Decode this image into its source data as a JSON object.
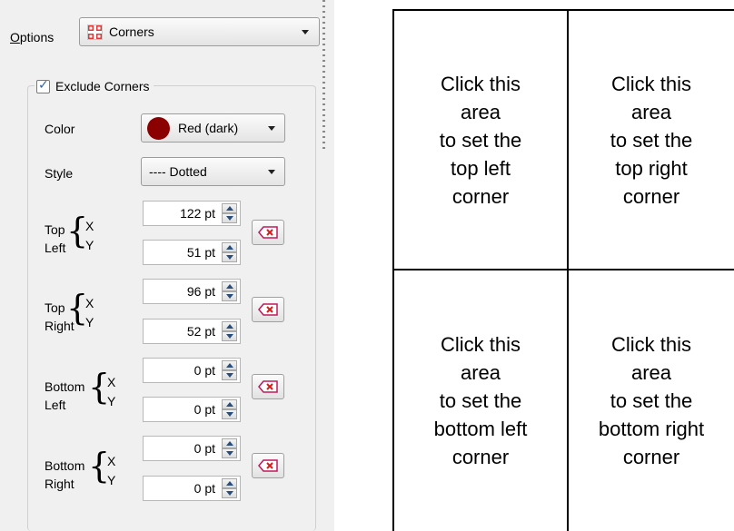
{
  "options": {
    "label_accel": "O",
    "label_rest": "ptions",
    "selected": "Corners"
  },
  "group": {
    "title": "Exclude Corners",
    "checked": true
  },
  "color": {
    "label": "Color",
    "value": "Red (dark)",
    "swatch": "#8b0000"
  },
  "style": {
    "label": "Style",
    "value": "---- Dotted"
  },
  "corners": [
    {
      "label1": "Top",
      "label2": "Left",
      "x": "122 pt",
      "y": "51 pt"
    },
    {
      "label1": "Top",
      "label2": "Right",
      "x": "96 pt",
      "y": "52 pt"
    },
    {
      "label1": "Bottom",
      "label2": "Left",
      "x": "0 pt",
      "y": "0 pt"
    },
    {
      "label1": "Bottom",
      "label2": "Right",
      "x": "0 pt",
      "y": "0 pt"
    }
  ],
  "axis": {
    "x": "X",
    "y": "Y"
  },
  "icons": {
    "corners": "corners-icon",
    "clear": "clear-icon"
  },
  "grid": {
    "top_left": "Click this\narea\nto set the\ntop left\ncorner",
    "top_right": "Click this\narea\nto set the\ntop right\ncorner",
    "bottom_left": "Click this\narea\nto set the\nbottom left\ncorner",
    "bottom_right": "Click this\narea\nto set the\nbottom right\ncorner"
  }
}
